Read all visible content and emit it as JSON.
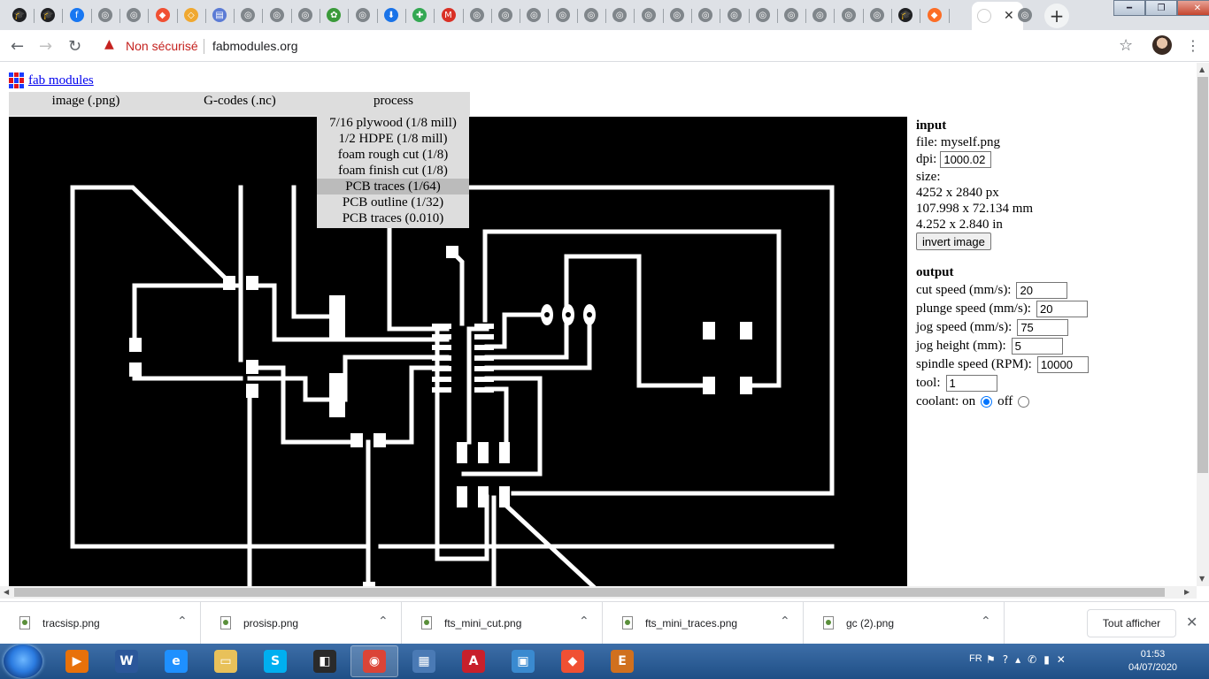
{
  "browser": {
    "tabs": [
      {
        "icon": "graduation-cap-icon",
        "color": "#202124",
        "glyph": "🎓"
      },
      {
        "icon": "graduation-cap-icon",
        "color": "#202124",
        "glyph": "🎓"
      },
      {
        "icon": "facebook-icon",
        "color": "#1877f2",
        "glyph": "f"
      },
      {
        "icon": "globe-icon",
        "color": "#80868b",
        "glyph": "◎"
      },
      {
        "icon": "globe-icon",
        "color": "#80868b",
        "glyph": "◎"
      },
      {
        "icon": "git-icon",
        "color": "#f05033",
        "glyph": "◆"
      },
      {
        "icon": "git-icon",
        "color": "#f0a830",
        "glyph": "◇"
      },
      {
        "icon": "document-icon",
        "color": "#5b7bd5",
        "glyph": "▤"
      },
      {
        "icon": "globe-icon",
        "color": "#80868b",
        "glyph": "◎"
      },
      {
        "icon": "globe-icon",
        "color": "#80868b",
        "glyph": "◎"
      },
      {
        "icon": "globe-icon",
        "color": "#80868b",
        "glyph": "◎"
      },
      {
        "icon": "opensource-icon",
        "color": "#3a9a3a",
        "glyph": "✿"
      },
      {
        "icon": "globe-icon",
        "color": "#80868b",
        "glyph": "◎"
      },
      {
        "icon": "download-icon",
        "color": "#1a73e8",
        "glyph": "⬇"
      },
      {
        "icon": "puzzle-icon",
        "color": "#34a853",
        "glyph": "✚"
      },
      {
        "icon": "gmail-icon",
        "color": "#d93025",
        "glyph": "M"
      },
      {
        "icon": "globe-icon",
        "color": "#80868b",
        "glyph": "◎"
      },
      {
        "icon": "globe-icon",
        "color": "#80868b",
        "glyph": "◎"
      },
      {
        "icon": "globe-icon",
        "color": "#80868b",
        "glyph": "◎"
      },
      {
        "icon": "globe-icon",
        "color": "#80868b",
        "glyph": "◎"
      },
      {
        "icon": "globe-icon",
        "color": "#80868b",
        "glyph": "◎"
      },
      {
        "icon": "globe-icon",
        "color": "#80868b",
        "glyph": "◎"
      },
      {
        "icon": "globe-icon",
        "color": "#80868b",
        "glyph": "◎"
      },
      {
        "icon": "globe-icon",
        "color": "#80868b",
        "glyph": "◎"
      },
      {
        "icon": "globe-icon",
        "color": "#80868b",
        "glyph": "◎"
      },
      {
        "icon": "globe-icon",
        "color": "#80868b",
        "glyph": "◎"
      },
      {
        "icon": "globe-icon",
        "color": "#80868b",
        "glyph": "◎"
      },
      {
        "icon": "globe-icon",
        "color": "#80868b",
        "glyph": "◎"
      },
      {
        "icon": "globe-icon",
        "color": "#80868b",
        "glyph": "◎"
      },
      {
        "icon": "globe-icon",
        "color": "#80868b",
        "glyph": "◎"
      },
      {
        "icon": "globe-icon",
        "color": "#80868b",
        "glyph": "◎"
      },
      {
        "icon": "graduation-cap-icon",
        "color": "#202124",
        "glyph": "🎓"
      },
      {
        "icon": "gitlab-icon",
        "color": "#fc6d26",
        "glyph": "◆"
      }
    ],
    "active_tab": {
      "icon": "close-icon",
      "glyph": "✕"
    },
    "after_tab": {
      "icon": "globe-icon",
      "color": "#80868b",
      "glyph": "◎"
    },
    "new_tab_glyph": "+",
    "security_label": "Non sécurisé",
    "url": "fabmodules.org"
  },
  "page": {
    "logo_text": "fab modules",
    "menu": {
      "image": "image (.png)",
      "gcodes": "G-codes (.nc)",
      "process": "process"
    },
    "process_options": [
      "7/16 plywood (1/8 mill)",
      "1/2 HDPE (1/8 mill)",
      "foam rough cut (1/8)",
      "foam finish cut (1/8)",
      "PCB traces (1/64)",
      "PCB outline (1/32)",
      "PCB traces (0.010)"
    ],
    "selected_option_index": 4,
    "input": {
      "heading": "input",
      "file_label": "file:",
      "file_value": "myself.png",
      "dpi_label": "dpi:",
      "dpi_value": "1000.02",
      "size_label": "size:",
      "size_px": "4252 x 2840 px",
      "size_mm": "107.998 x 72.134 mm",
      "size_in": "4.252 x 2.840 in",
      "invert_button": "invert image"
    },
    "output": {
      "heading": "output",
      "cut_speed_label": "cut speed (mm/s):",
      "cut_speed": "20",
      "plunge_speed_label": "plunge speed (mm/s):",
      "plunge_speed": "20",
      "jog_speed_label": "jog speed (mm/s):",
      "jog_speed": "75",
      "jog_height_label": "jog height (mm):",
      "jog_height": "5",
      "spindle_label": "spindle speed (RPM):",
      "spindle_speed": "10000",
      "tool_label": "tool:",
      "tool": "1",
      "coolant_label": "coolant: on",
      "coolant_off_label": "off",
      "coolant": "on"
    }
  },
  "downloads": {
    "files": [
      "tracsisp.png",
      "prosisp.png",
      "fts_mini_cut.png",
      "fts_mini_traces.png",
      "gc (2).png"
    ],
    "show_all": "Tout afficher"
  },
  "taskbar": {
    "apps": [
      {
        "name": "media-player-icon",
        "color": "#e8710a",
        "glyph": "▶"
      },
      {
        "name": "word-icon",
        "color": "#2b579a",
        "glyph": "W"
      },
      {
        "name": "internet-explorer-icon",
        "color": "#1e90ff",
        "glyph": "e"
      },
      {
        "name": "file-explorer-icon",
        "color": "#e8c15a",
        "glyph": "▭"
      },
      {
        "name": "skype-icon",
        "color": "#00aff0",
        "glyph": "S"
      },
      {
        "name": "app-window-icon",
        "color": "#2a2a2a",
        "glyph": "◧"
      },
      {
        "name": "chrome-icon",
        "color": "#db4437",
        "glyph": "◉"
      },
      {
        "name": "control-panel-icon",
        "color": "#4a7ab5",
        "glyph": "▦"
      },
      {
        "name": "acrobat-icon",
        "color": "#c8202b",
        "glyph": "A"
      },
      {
        "name": "photo-viewer-icon",
        "color": "#3a8ad0",
        "glyph": "▣"
      },
      {
        "name": "git-icon",
        "color": "#f05033",
        "glyph": "◆"
      },
      {
        "name": "eagle-icon",
        "color": "#d0701e",
        "glyph": "E"
      }
    ],
    "active_app": 6,
    "lang": "FR",
    "time": "01:53",
    "date": "04/07/2020"
  }
}
